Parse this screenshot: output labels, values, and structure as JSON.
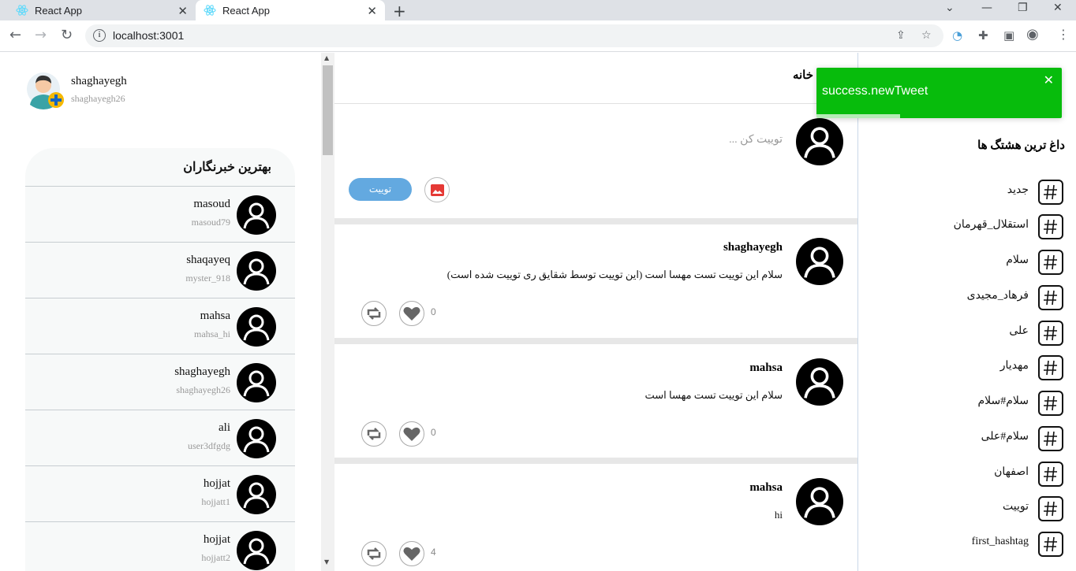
{
  "browser": {
    "tabs": [
      {
        "title": "React App"
      },
      {
        "title": "React App"
      }
    ],
    "url": "localhost:3001"
  },
  "profile": {
    "name": "shaghayegh",
    "username": "shaghayegh26"
  },
  "best_users": {
    "title": "بهترین خبرنگاران",
    "items": [
      {
        "name": "masoud",
        "username": "masoud79"
      },
      {
        "name": "shaqayeq",
        "username": "myster_918"
      },
      {
        "name": "mahsa",
        "username": "mahsa_hi"
      },
      {
        "name": "shaghayegh",
        "username": "shaghayegh26"
      },
      {
        "name": "ali",
        "username": "user3dfgdg"
      },
      {
        "name": "hojjat",
        "username": "hojjatt1"
      },
      {
        "name": "hojjat",
        "username": "hojjatt2"
      }
    ]
  },
  "main": {
    "title": "خانه",
    "compose": {
      "placeholder": "توییت کن ...",
      "button": "توییت"
    },
    "tweets": [
      {
        "name": "shaghayegh",
        "text": "سلام این توییت تست مهسا است (این توییت توسط شقایق ری توییت شده است)",
        "likes": "0"
      },
      {
        "name": "mahsa",
        "text": "سلام این توییت تست مهسا است",
        "likes": "0"
      },
      {
        "name": "mahsa",
        "text": "hi",
        "likes": "4"
      }
    ]
  },
  "trends": {
    "title": "داغ ترین هشتگ ها",
    "items": [
      "جدید",
      "استقلال_قهرمان",
      "سلام",
      "فرهاد_مجیدی",
      "علی",
      "مهدیار",
      "سلام#سلام",
      "سلام#علی",
      "اصفهان",
      "توییت",
      "first_hashtag"
    ]
  },
  "toast": {
    "message": "success.newTweet",
    "progress": 0.34,
    "color": "#07bc0c"
  }
}
